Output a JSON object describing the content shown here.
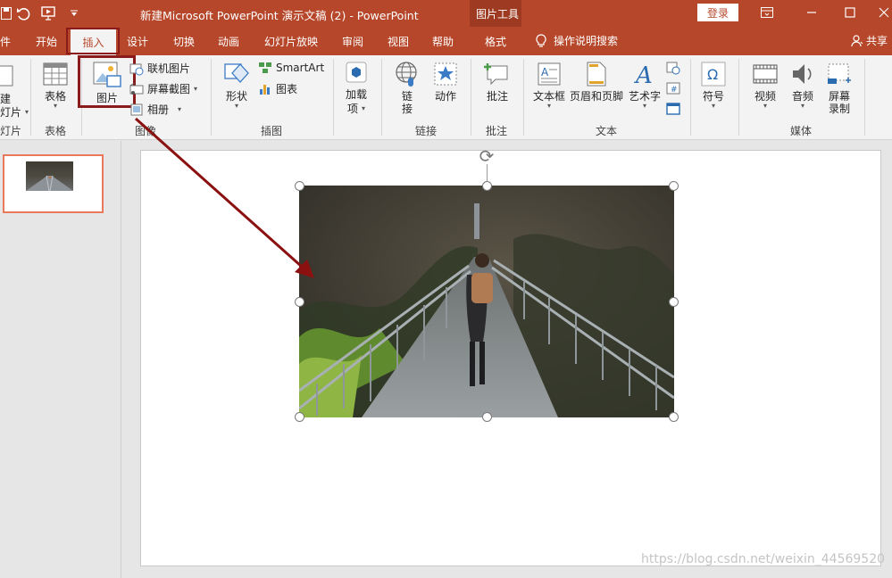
{
  "titlebar": {
    "doc_title": "新建Microsoft PowerPoint 演示文稿 (2)  -  PowerPoint",
    "context_tool": "图片工具",
    "login": "登录"
  },
  "tabs": [
    {
      "label": "件"
    },
    {
      "label": "开始"
    },
    {
      "label": "插入"
    },
    {
      "label": "设计"
    },
    {
      "label": "切换"
    },
    {
      "label": "动画"
    },
    {
      "label": "幻灯片放映"
    },
    {
      "label": "审阅"
    },
    {
      "label": "视图"
    },
    {
      "label": "帮助"
    },
    {
      "label": "格式"
    }
  ],
  "tell_me": "操作说明搜索",
  "share": "共享",
  "ribbon": {
    "new_slide_label_top": "建",
    "new_slide_label_bottom": "灯片",
    "group_slides": "灯片",
    "table": "表格",
    "group_tables": "表格",
    "pictures": "图片",
    "online_pictures": "联机图片",
    "screenshot": "屏幕截图",
    "album": "相册",
    "group_images": "图像",
    "shapes": "形状",
    "smartart": "SmartArt",
    "chart": "图表",
    "group_illustrations": "插图",
    "addins_top": "加载",
    "addins_bottom": "项",
    "link_top": "链",
    "link_bottom": "接",
    "action": "动作",
    "group_links": "链接",
    "comment": "批注",
    "group_comments": "批注",
    "textbox": "文本框",
    "header_footer": "页眉和页脚",
    "wordart": "艺术字",
    "group_text": "文本",
    "symbol": "符号",
    "video": "视频",
    "audio": "音频",
    "screen_rec_top": "屏幕",
    "screen_rec_bottom": "录制",
    "group_media": "媒体"
  },
  "slides": [
    {
      "number": "1"
    }
  ],
  "watermark": "https://blog.csdn.net/weixin_44569520",
  "colors": {
    "accent": "#b7472a",
    "highlight_box": "#8b1a1a",
    "arrow": "#8b1010",
    "thumb_border": "#e8795d"
  }
}
